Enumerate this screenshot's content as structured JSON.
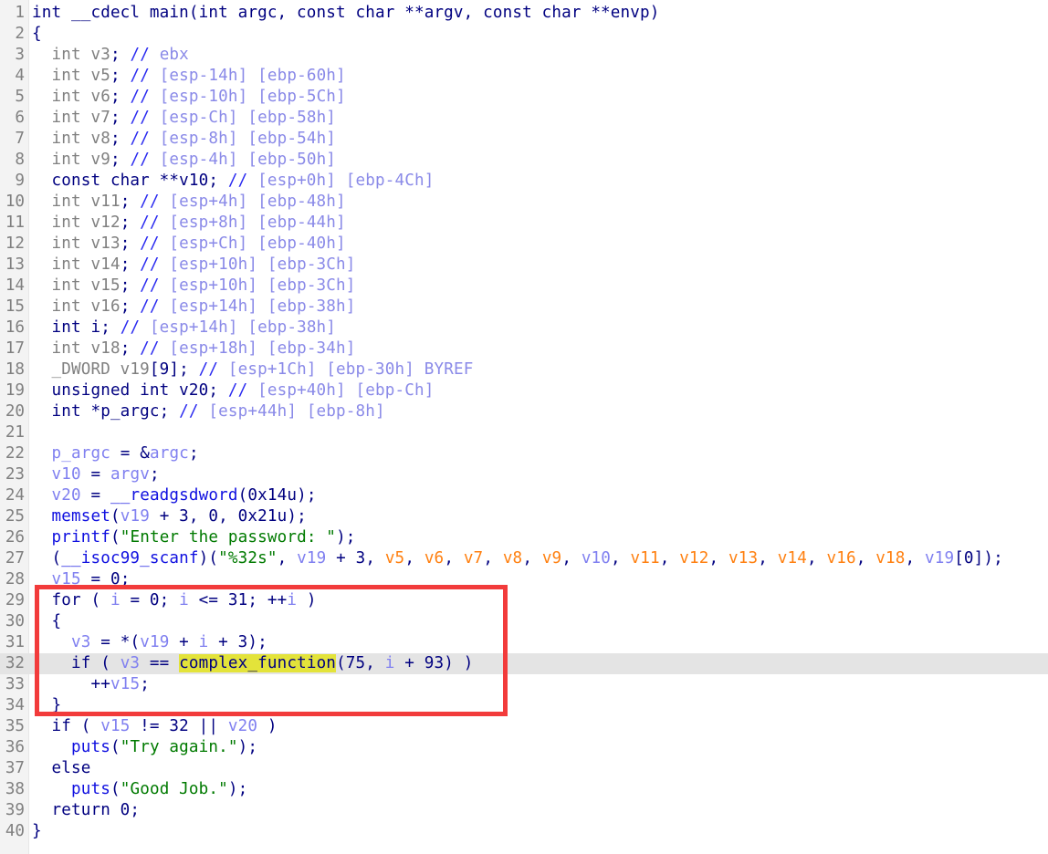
{
  "view": "pseudocode",
  "colors": {
    "keyword": "#000080",
    "unused_decl": "#808080",
    "comment": "#8a8ae8",
    "variable": "#8080f0",
    "function": "#1010e0",
    "string": "#007a00",
    "argument": "#ff8010",
    "highlight": "#e3e33a",
    "annotation_box": "#f23b3b"
  },
  "current_line": 32,
  "annotation_box_lines": [
    29,
    34
  ],
  "lines": [
    {
      "n": "1",
      "tokens": [
        {
          "c": "k",
          "t": "int __cdecl main(int argc, const char **argv, const char **envp)"
        }
      ]
    },
    {
      "n": "2",
      "tokens": [
        {
          "c": "k",
          "t": "{"
        }
      ]
    },
    {
      "n": "3",
      "tokens": [
        {
          "c": "g",
          "t": "  int v3"
        },
        {
          "c": "k",
          "t": ";"
        },
        {
          "c": "c",
          "t": " // "
        },
        {
          "c": "cm",
          "t": "ebx"
        }
      ]
    },
    {
      "n": "4",
      "tokens": [
        {
          "c": "g",
          "t": "  int v5"
        },
        {
          "c": "k",
          "t": ";"
        },
        {
          "c": "c",
          "t": " // "
        },
        {
          "c": "cm",
          "t": "[esp-14h] [ebp-60h]"
        }
      ]
    },
    {
      "n": "5",
      "tokens": [
        {
          "c": "g",
          "t": "  int v6"
        },
        {
          "c": "k",
          "t": ";"
        },
        {
          "c": "c",
          "t": " // "
        },
        {
          "c": "cm",
          "t": "[esp-10h] [ebp-5Ch]"
        }
      ]
    },
    {
      "n": "6",
      "tokens": [
        {
          "c": "g",
          "t": "  int v7"
        },
        {
          "c": "k",
          "t": ";"
        },
        {
          "c": "c",
          "t": " // "
        },
        {
          "c": "cm",
          "t": "[esp-Ch] [ebp-58h]"
        }
      ]
    },
    {
      "n": "7",
      "tokens": [
        {
          "c": "g",
          "t": "  int v8"
        },
        {
          "c": "k",
          "t": ";"
        },
        {
          "c": "c",
          "t": " // "
        },
        {
          "c": "cm",
          "t": "[esp-8h] [ebp-54h]"
        }
      ]
    },
    {
      "n": "8",
      "tokens": [
        {
          "c": "g",
          "t": "  int v9"
        },
        {
          "c": "k",
          "t": ";"
        },
        {
          "c": "c",
          "t": " // "
        },
        {
          "c": "cm",
          "t": "[esp-4h] [ebp-50h]"
        }
      ]
    },
    {
      "n": "9",
      "tokens": [
        {
          "c": "k",
          "t": "  const char **v10;"
        },
        {
          "c": "c",
          "t": " // "
        },
        {
          "c": "cm",
          "t": "[esp+0h] [ebp-4Ch]"
        }
      ]
    },
    {
      "n": "10",
      "tokens": [
        {
          "c": "g",
          "t": "  int v11"
        },
        {
          "c": "k",
          "t": ";"
        },
        {
          "c": "c",
          "t": " // "
        },
        {
          "c": "cm",
          "t": "[esp+4h] [ebp-48h]"
        }
      ]
    },
    {
      "n": "11",
      "tokens": [
        {
          "c": "g",
          "t": "  int v12"
        },
        {
          "c": "k",
          "t": ";"
        },
        {
          "c": "c",
          "t": " // "
        },
        {
          "c": "cm",
          "t": "[esp+8h] [ebp-44h]"
        }
      ]
    },
    {
      "n": "12",
      "tokens": [
        {
          "c": "g",
          "t": "  int v13"
        },
        {
          "c": "k",
          "t": ";"
        },
        {
          "c": "c",
          "t": " // "
        },
        {
          "c": "cm",
          "t": "[esp+Ch] [ebp-40h]"
        }
      ]
    },
    {
      "n": "13",
      "tokens": [
        {
          "c": "g",
          "t": "  int v14"
        },
        {
          "c": "k",
          "t": ";"
        },
        {
          "c": "c",
          "t": " // "
        },
        {
          "c": "cm",
          "t": "[esp+10h] [ebp-3Ch]"
        }
      ]
    },
    {
      "n": "14",
      "tokens": [
        {
          "c": "g",
          "t": "  int v15"
        },
        {
          "c": "k",
          "t": ";"
        },
        {
          "c": "c",
          "t": " // "
        },
        {
          "c": "cm",
          "t": "[esp+10h] [ebp-3Ch]"
        }
      ]
    },
    {
      "n": "15",
      "tokens": [
        {
          "c": "g",
          "t": "  int v16"
        },
        {
          "c": "k",
          "t": ";"
        },
        {
          "c": "c",
          "t": " // "
        },
        {
          "c": "cm",
          "t": "[esp+14h] [ebp-38h]"
        }
      ]
    },
    {
      "n": "16",
      "tokens": [
        {
          "c": "k",
          "t": "  int i;"
        },
        {
          "c": "c",
          "t": " // "
        },
        {
          "c": "cm",
          "t": "[esp+14h] [ebp-38h]"
        }
      ]
    },
    {
      "n": "17",
      "tokens": [
        {
          "c": "g",
          "t": "  int v18"
        },
        {
          "c": "k",
          "t": ";"
        },
        {
          "c": "c",
          "t": " // "
        },
        {
          "c": "cm",
          "t": "[esp+18h] [ebp-34h]"
        }
      ]
    },
    {
      "n": "18",
      "tokens": [
        {
          "c": "g",
          "t": "  _DWORD v19"
        },
        {
          "c": "k",
          "t": "[9];"
        },
        {
          "c": "c",
          "t": " // "
        },
        {
          "c": "cm",
          "t": "[esp+1Ch] [ebp-30h] BYREF"
        }
      ]
    },
    {
      "n": "19",
      "tokens": [
        {
          "c": "k",
          "t": "  unsigned int v20;"
        },
        {
          "c": "c",
          "t": " // "
        },
        {
          "c": "cm",
          "t": "[esp+40h] [ebp-Ch]"
        }
      ]
    },
    {
      "n": "20",
      "tokens": [
        {
          "c": "k",
          "t": "  int *p_argc;"
        },
        {
          "c": "c",
          "t": " // "
        },
        {
          "c": "cm",
          "t": "[esp+44h] [ebp-8h]"
        }
      ]
    },
    {
      "n": "21",
      "tokens": []
    },
    {
      "n": "22",
      "tokens": [
        {
          "c": "k",
          "t": "  "
        },
        {
          "c": "v",
          "t": "p_argc"
        },
        {
          "c": "k",
          "t": " = &"
        },
        {
          "c": "v",
          "t": "argc"
        },
        {
          "c": "k",
          "t": ";"
        }
      ]
    },
    {
      "n": "23",
      "tokens": [
        {
          "c": "k",
          "t": "  "
        },
        {
          "c": "v",
          "t": "v10"
        },
        {
          "c": "k",
          "t": " = "
        },
        {
          "c": "v",
          "t": "argv"
        },
        {
          "c": "k",
          "t": ";"
        }
      ]
    },
    {
      "n": "24",
      "tokens": [
        {
          "c": "k",
          "t": "  "
        },
        {
          "c": "v",
          "t": "v20"
        },
        {
          "c": "k",
          "t": " = "
        },
        {
          "c": "f",
          "t": "__readgsdword"
        },
        {
          "c": "k",
          "t": "(0x14u);"
        }
      ]
    },
    {
      "n": "25",
      "tokens": [
        {
          "c": "k",
          "t": "  "
        },
        {
          "c": "f",
          "t": "memset"
        },
        {
          "c": "k",
          "t": "("
        },
        {
          "c": "v",
          "t": "v19"
        },
        {
          "c": "k",
          "t": " + 3, 0, 0x21u);"
        }
      ]
    },
    {
      "n": "26",
      "tokens": [
        {
          "c": "k",
          "t": "  "
        },
        {
          "c": "f",
          "t": "printf"
        },
        {
          "c": "k",
          "t": "("
        },
        {
          "c": "s",
          "t": "\"Enter the password: \""
        },
        {
          "c": "k",
          "t": ");"
        }
      ]
    },
    {
      "n": "27",
      "tokens": [
        {
          "c": "k",
          "t": "  ("
        },
        {
          "c": "f",
          "t": "__isoc99_scanf"
        },
        {
          "c": "k",
          "t": ")("
        },
        {
          "c": "s",
          "t": "\"%32s\""
        },
        {
          "c": "k",
          "t": ", "
        },
        {
          "c": "v",
          "t": "v19"
        },
        {
          "c": "k",
          "t": " + 3, "
        },
        {
          "c": "o",
          "t": "v5"
        },
        {
          "c": "k",
          "t": ", "
        },
        {
          "c": "o",
          "t": "v6"
        },
        {
          "c": "k",
          "t": ", "
        },
        {
          "c": "o",
          "t": "v7"
        },
        {
          "c": "k",
          "t": ", "
        },
        {
          "c": "o",
          "t": "v8"
        },
        {
          "c": "k",
          "t": ", "
        },
        {
          "c": "o",
          "t": "v9"
        },
        {
          "c": "k",
          "t": ", "
        },
        {
          "c": "v",
          "t": "v10"
        },
        {
          "c": "k",
          "t": ", "
        },
        {
          "c": "o",
          "t": "v11"
        },
        {
          "c": "k",
          "t": ", "
        },
        {
          "c": "o",
          "t": "v12"
        },
        {
          "c": "k",
          "t": ", "
        },
        {
          "c": "o",
          "t": "v13"
        },
        {
          "c": "k",
          "t": ", "
        },
        {
          "c": "o",
          "t": "v14"
        },
        {
          "c": "k",
          "t": ", "
        },
        {
          "c": "o",
          "t": "v16"
        },
        {
          "c": "k",
          "t": ", "
        },
        {
          "c": "o",
          "t": "v18"
        },
        {
          "c": "k",
          "t": ", "
        },
        {
          "c": "v",
          "t": "v19"
        },
        {
          "c": "k",
          "t": "[0]);"
        }
      ]
    },
    {
      "n": "28",
      "tokens": [
        {
          "c": "k",
          "t": "  "
        },
        {
          "c": "v",
          "t": "v15"
        },
        {
          "c": "k",
          "t": " = 0;"
        }
      ]
    },
    {
      "n": "29",
      "tokens": [
        {
          "c": "k",
          "t": "  for ( "
        },
        {
          "c": "v",
          "t": "i"
        },
        {
          "c": "k",
          "t": " = 0; "
        },
        {
          "c": "v",
          "t": "i"
        },
        {
          "c": "k",
          "t": " <= 31; ++"
        },
        {
          "c": "v",
          "t": "i"
        },
        {
          "c": "k",
          "t": " )"
        }
      ]
    },
    {
      "n": "30",
      "tokens": [
        {
          "c": "k",
          "t": "  {"
        }
      ]
    },
    {
      "n": "31",
      "tokens": [
        {
          "c": "k",
          "t": "    "
        },
        {
          "c": "v",
          "t": "v3"
        },
        {
          "c": "k",
          "t": " = *("
        },
        {
          "c": "v",
          "t": "v19"
        },
        {
          "c": "k",
          "t": " + "
        },
        {
          "c": "v",
          "t": "i"
        },
        {
          "c": "k",
          "t": " + 3);"
        }
      ]
    },
    {
      "n": "32",
      "tokens": [
        {
          "c": "k",
          "t": "    if ( "
        },
        {
          "c": "v",
          "t": "v3"
        },
        {
          "c": "k",
          "t": " == "
        },
        {
          "c": "h",
          "t": "complex_function"
        },
        {
          "c": "k",
          "t": "(75, "
        },
        {
          "c": "v",
          "t": "i"
        },
        {
          "c": "k",
          "t": " + 93) )"
        }
      ]
    },
    {
      "n": "33",
      "tokens": [
        {
          "c": "k",
          "t": "      ++"
        },
        {
          "c": "v",
          "t": "v15"
        },
        {
          "c": "k",
          "t": ";"
        }
      ]
    },
    {
      "n": "34",
      "tokens": [
        {
          "c": "k",
          "t": "  }"
        }
      ]
    },
    {
      "n": "35",
      "tokens": [
        {
          "c": "k",
          "t": "  if ( "
        },
        {
          "c": "v",
          "t": "v15"
        },
        {
          "c": "k",
          "t": " != 32 || "
        },
        {
          "c": "v",
          "t": "v20"
        },
        {
          "c": "k",
          "t": " )"
        }
      ]
    },
    {
      "n": "36",
      "tokens": [
        {
          "c": "k",
          "t": "    "
        },
        {
          "c": "f",
          "t": "puts"
        },
        {
          "c": "k",
          "t": "("
        },
        {
          "c": "s",
          "t": "\"Try again.\""
        },
        {
          "c": "k",
          "t": ");"
        }
      ]
    },
    {
      "n": "37",
      "tokens": [
        {
          "c": "k",
          "t": "  else"
        }
      ]
    },
    {
      "n": "38",
      "tokens": [
        {
          "c": "k",
          "t": "    "
        },
        {
          "c": "f",
          "t": "puts"
        },
        {
          "c": "k",
          "t": "("
        },
        {
          "c": "s",
          "t": "\"Good Job.\""
        },
        {
          "c": "k",
          "t": ");"
        }
      ]
    },
    {
      "n": "39",
      "tokens": [
        {
          "c": "k",
          "t": "  return 0;"
        }
      ]
    },
    {
      "n": "40",
      "tokens": [
        {
          "c": "k",
          "t": "}"
        }
      ]
    }
  ]
}
